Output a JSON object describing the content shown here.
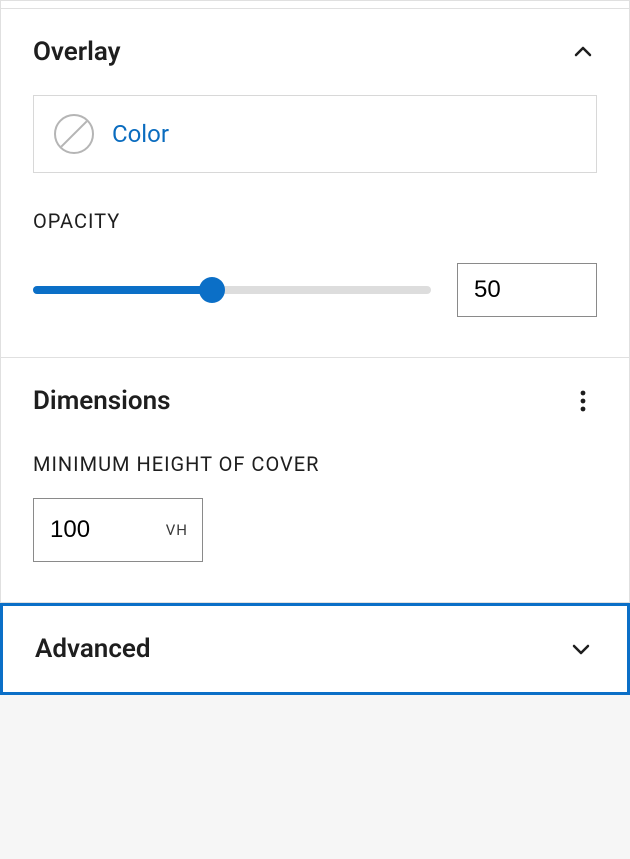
{
  "sections": {
    "overlay": {
      "title": "Overlay",
      "expanded": true,
      "color": {
        "label": "Color",
        "value": null
      },
      "opacity": {
        "label": "OPACITY",
        "value": "50",
        "percent": 45
      }
    },
    "dimensions": {
      "title": "Dimensions",
      "minHeight": {
        "label": "MINIMUM HEIGHT OF COVER",
        "value": "100",
        "unit": "VH"
      }
    },
    "advanced": {
      "title": "Advanced",
      "expanded": false
    }
  }
}
